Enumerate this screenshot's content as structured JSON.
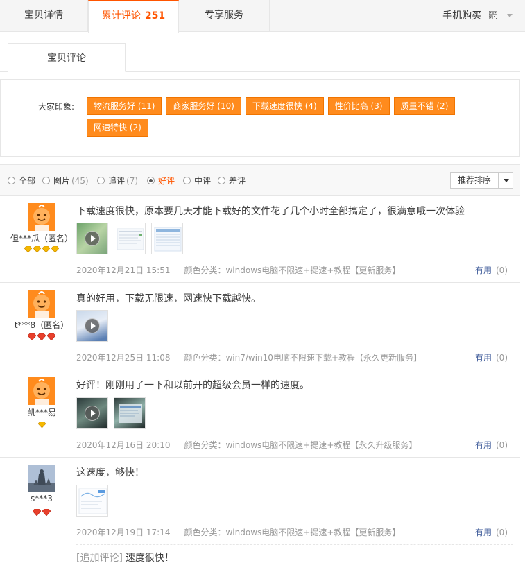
{
  "top_tabs": [
    {
      "label": "宝贝详情"
    },
    {
      "label": "累计评论",
      "count": "251"
    },
    {
      "label": "专享服务"
    }
  ],
  "mobile_buy": "手机购买",
  "sub_tab": "宝贝评论",
  "impressions": {
    "label": "大家印象:",
    "tags": [
      "物流服务好 (11)",
      "商家服务好 (10)",
      "下载速度很快 (4)",
      "性价比高 (3)",
      "质量不错 (2)",
      "网速特快 (2)"
    ]
  },
  "filters": [
    {
      "label": "全部",
      "count": ""
    },
    {
      "label": "图片",
      "count": "(45)"
    },
    {
      "label": "追评",
      "count": "(7)"
    },
    {
      "label": "好评",
      "count": ""
    },
    {
      "label": "中评",
      "count": ""
    },
    {
      "label": "差评",
      "count": ""
    }
  ],
  "selected_filter": "好评",
  "sort_label": "推荐排序",
  "useful_label": "有用",
  "reviews": [
    {
      "user": "但***瓜（匿名）",
      "text": "下载速度很快，原本要几天才能下载好的文件花了几个小时全部搞定了，很满意哦一次体验",
      "date": "2020年12月21日 15:51",
      "sku": "颜色分类：windows电脑不限速+提速+教程【更新服务】",
      "useful_count": "(0)"
    },
    {
      "user": "t***8（匿名）",
      "text": "真的好用，下载无限速，网速快下载越快。",
      "date": "2020年12月25日 11:08",
      "sku": "颜色分类：win7/win10电脑不限速下载+教程【永久更新服务】",
      "useful_count": "(0)"
    },
    {
      "user": "凯***易",
      "text": "好评！刚刚用了一下和以前开的超级会员一样的速度。",
      "date": "2020年12月16日 20:10",
      "sku": "颜色分类：windows电脑不限速+提速+教程【永久升级服务】",
      "useful_count": "(0)"
    },
    {
      "user": "s***3",
      "text": "这速度，够快！",
      "date": "2020年12月19日 17:14",
      "sku": "颜色分类：windows电脑不限速+提速+教程【更新服务】",
      "useful_count": "(0)",
      "append_label": "[追加评论]",
      "append_text": "速度很快！"
    }
  ],
  "colors": {
    "accent": "#ff5500",
    "tag_bg": "#ff8b1d",
    "link": "#3d5a99"
  }
}
